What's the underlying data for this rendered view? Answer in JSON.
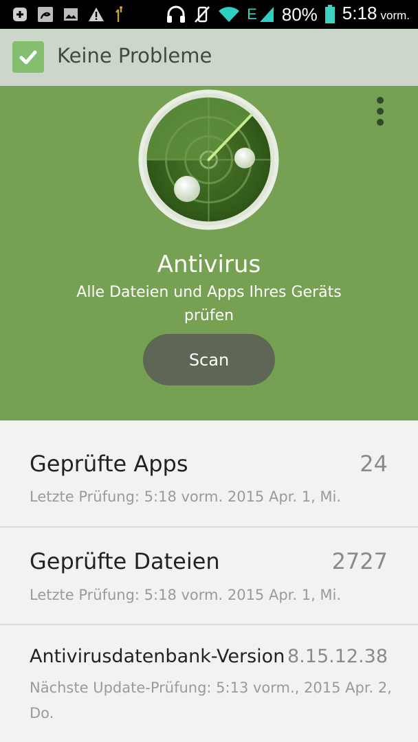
{
  "status_bar": {
    "battery_percent": "80%",
    "time": "5:18",
    "time_suffix": "vorm.",
    "network_type": "E",
    "icons": [
      "notification-plus-icon",
      "app-notification-icon",
      "image-notification-icon",
      "warning-icon",
      "usb-debug-icon",
      "headset-icon",
      "vibrate-mute-icon",
      "wifi-icon",
      "signal-icon",
      "battery-icon"
    ]
  },
  "header": {
    "title": "Keine Probleme",
    "status_icon": "check-icon"
  },
  "hero": {
    "title": "Antivirus",
    "subtitle": "Alle Dateien und Apps Ihres Geräts prüfen",
    "scan_label": "Scan",
    "menu_icon": "overflow-menu-icon",
    "illustration_icon": "radar-icon"
  },
  "rows": [
    {
      "title": "Geprüfte Apps",
      "value": "24",
      "detail": "Letzte Prüfung: 5:18 vorm. 2015 Apr. 1, Mi."
    },
    {
      "title": "Geprüfte Dateien",
      "value": "2727",
      "detail": "Letzte Prüfung: 5:18 vorm. 2015 Apr. 1, Mi."
    },
    {
      "title": "Antivirusdatenbank-Version",
      "value": "8.15.12.38",
      "detail": "Nächste Update-Prüfung: 5:13 vorm., 2015 Apr. 2, Do."
    }
  ],
  "colors": {
    "hero_green": "#76a052",
    "header_bg": "#cdd6cb",
    "check_green": "#83bf6e",
    "scan_button": "#5e6756",
    "battery": "#3fd2c0",
    "wifi": "#2fd0c3"
  }
}
